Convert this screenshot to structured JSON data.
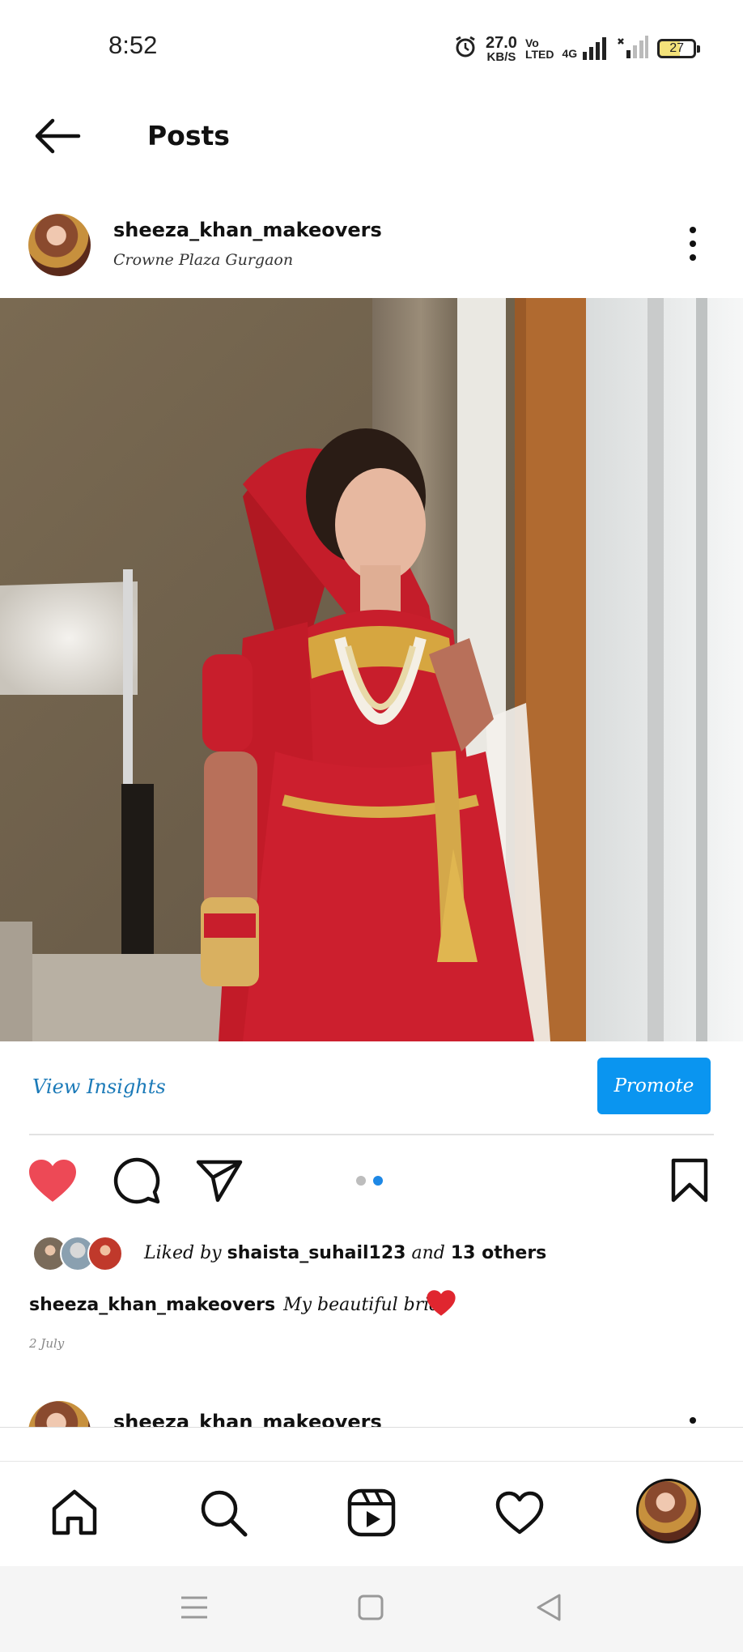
{
  "status_bar": {
    "time": "8:52",
    "network_speed_value": "27.0",
    "network_speed_unit": "KB/S",
    "volte_top": "Vo",
    "volte_bottom": "LTED",
    "network_type": "4G",
    "battery_level": "27"
  },
  "header": {
    "title": "Posts"
  },
  "post": {
    "username": "sheeza_khan_makeovers",
    "location": "Crowne Plaza Gurgaon",
    "view_insights_label": "View Insights",
    "promote_label": "Promote",
    "carousel": {
      "total": 2,
      "active_index": 1
    },
    "likes": {
      "prefix": "Liked by",
      "user": "shaista_suhail123",
      "conjunction": "and",
      "others": "13 others"
    },
    "caption": {
      "username": "sheeza_khan_makeovers",
      "text": "My beautiful bride",
      "emoji": "❤️"
    },
    "date": "2 July",
    "liked": true
  },
  "next_post": {
    "username": "sheeza_khan_makeovers"
  },
  "colors": {
    "accent_blue": "#0a95f0",
    "link_blue": "#1b7ab8",
    "like_red": "#ed4956",
    "dot_active": "#1e88e5",
    "dot_inactive": "#bdbdbd"
  }
}
